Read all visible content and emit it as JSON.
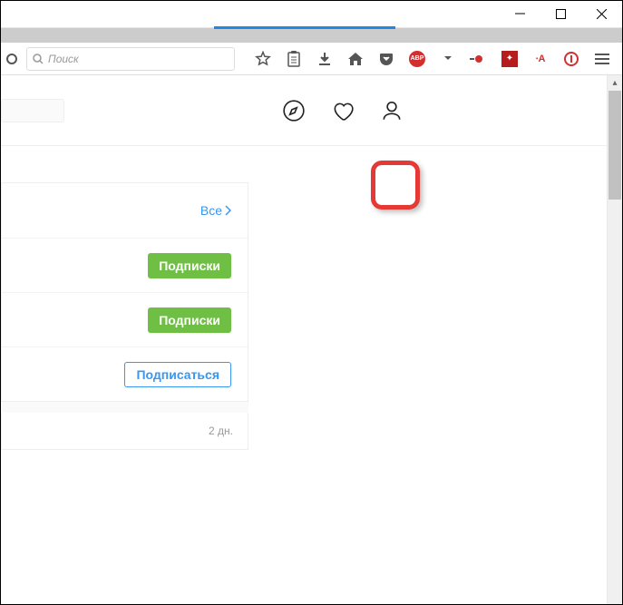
{
  "window": {
    "min": "—",
    "max": "◻",
    "close": "✕"
  },
  "toolbar": {
    "search_placeholder": "Поиск",
    "abp": "ABP",
    "ra": "∙A"
  },
  "nav": {
    "explore": "explore",
    "likes": "likes",
    "profile": "profile"
  },
  "feed": {
    "all_label": "Все",
    "subs1": "Подписки",
    "subs2": "Подписки",
    "follow": "Подписаться",
    "time": "2 дн."
  }
}
